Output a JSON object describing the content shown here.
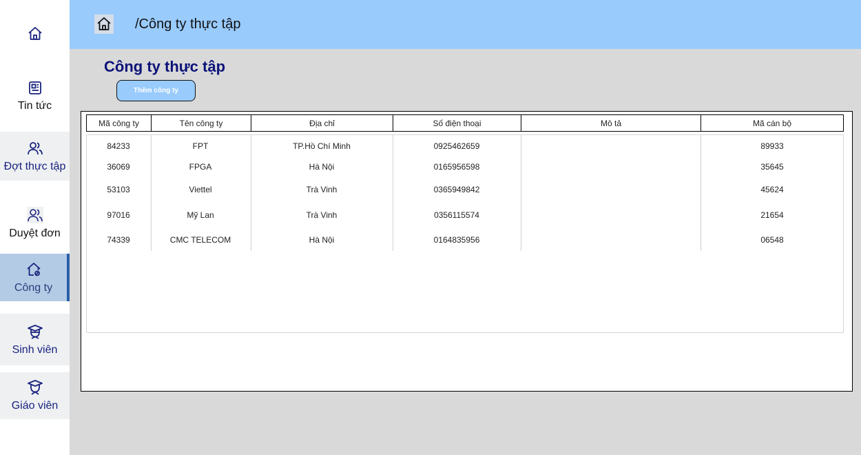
{
  "sidebar": {
    "items": [
      {
        "label": "",
        "icon": "home-icon"
      },
      {
        "label": "Tin tức",
        "icon": "newspaper-icon"
      },
      {
        "label": "Đợt thực tập",
        "icon": "users-icon"
      },
      {
        "label": "Duyệt đơn",
        "icon": "users-icon"
      },
      {
        "label": "Công ty",
        "icon": "building-icon",
        "active": true
      },
      {
        "label": "Sinh viên",
        "icon": "student-icon"
      },
      {
        "label": "Giáo viên",
        "icon": "teacher-icon"
      }
    ]
  },
  "header": {
    "breadcrumb": "/Công ty thực tập",
    "background": "#99cbfd"
  },
  "main": {
    "title": "Công ty thực tập",
    "add_button": "Thêm công ty",
    "table": {
      "columns": [
        "Mã công ty",
        "Tên công ty",
        "Địa chỉ",
        "Số điện thoại",
        "Mô tả",
        "Mã cán bộ"
      ],
      "rows": [
        [
          "84233",
          "FPT",
          "TP.Hồ Chí Minh",
          "0925462659",
          "",
          "89933"
        ],
        [
          "36069",
          "FPGA",
          "Hà Nội",
          "0165956598",
          "",
          "35645"
        ],
        [
          "53103",
          "Viettel",
          "Trà Vinh",
          "0365949842",
          "",
          "45624"
        ],
        [
          "97016",
          "Mỹ Lan",
          "Trà Vinh",
          "0356115574",
          "",
          "21654"
        ],
        [
          "74339",
          "CMC TELECOM",
          "Hà Nội",
          "0164835956",
          "",
          "06548"
        ]
      ]
    }
  },
  "colors": {
    "accent": "#99cbfd",
    "title": "#0c1278",
    "active_nav": "#b4cbe6"
  }
}
